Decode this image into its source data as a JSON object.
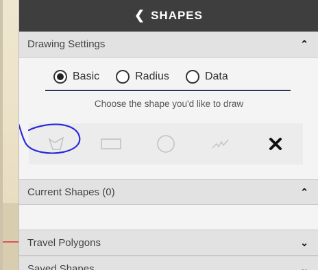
{
  "header": {
    "title": "SHAPES",
    "back_icon": "chevron-left-icon"
  },
  "drawing_settings": {
    "label": "Drawing Settings",
    "expanded": true,
    "modes": [
      {
        "label": "Basic",
        "selected": true
      },
      {
        "label": "Radius",
        "selected": false
      },
      {
        "label": "Data",
        "selected": false
      }
    ],
    "hint": "Choose the shape you'd like to draw",
    "tools": [
      "polygon-icon",
      "rectangle-icon",
      "circle-icon",
      "freehand-line-icon",
      "clear-x-icon"
    ]
  },
  "current_shapes": {
    "label": "Current Shapes (0)",
    "expanded": true
  },
  "travel_polygons": {
    "label": "Travel Polygons",
    "expanded": false
  },
  "saved_shapes": {
    "label": "Saved Shapes",
    "expanded": false
  },
  "colors": {
    "header_bg": "#3e3e3e",
    "rule": "#273a5c",
    "annotation": "#2a2adb"
  }
}
